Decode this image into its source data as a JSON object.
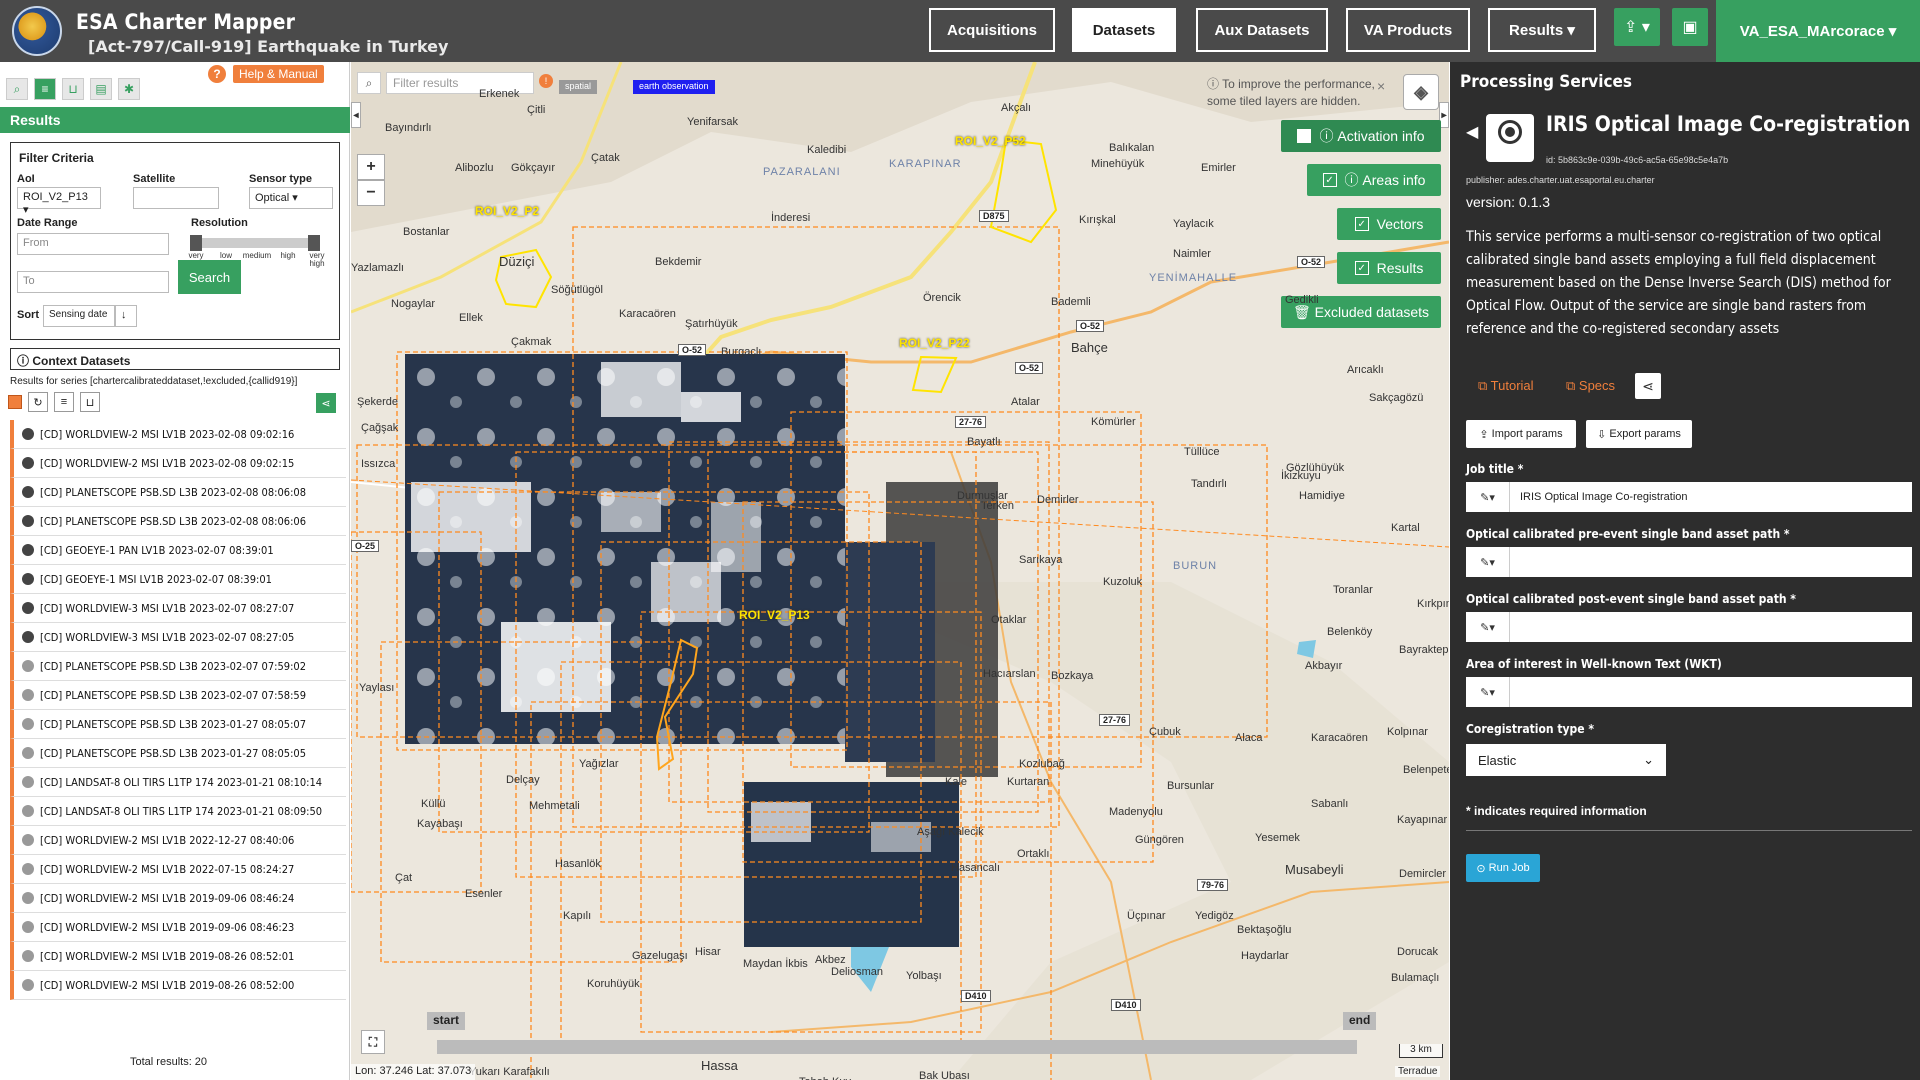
{
  "header": {
    "app_title": "ESA Charter Mapper",
    "activation_title": "[Act-797/Call-919] Earthquake in Turkey",
    "nav": [
      "Acquisitions",
      "Datasets",
      "Aux Datasets",
      "VA Products",
      "Results ▾"
    ],
    "active_nav": "Datasets",
    "upload_label": "⇪ ▾",
    "briefcase_label": "▣",
    "user": "VA_ESA_MArcorace ▾"
  },
  "left_panel": {
    "help_q": "?",
    "help_label": "Help & Manual",
    "results_label": "Results",
    "filter": {
      "title": "Filter Criteria",
      "aoi_label": "AoI",
      "aoi_value": "ROI_V2_P13",
      "satellite_label": "Satellite",
      "satellite_value": "",
      "sensor_label": "Sensor type",
      "sensor_value": "Optical",
      "date_label": "Date Range",
      "from_placeholder": "From",
      "to_placeholder": "To",
      "resolution_label": "Resolution",
      "resolution_ticks": [
        "very low",
        "low",
        "medium",
        "high",
        "very high"
      ],
      "sort_label": "Sort",
      "sort_value": "Sensing date",
      "search_label": "Search"
    },
    "context_title": "Context Datasets",
    "context_subtitle": "Results for series [chartercalibrateddataset,!excluded,{callid919}]",
    "datasets": [
      {
        "label": "[CD] WORLDVIEW-2 MSI LV1B 2023-02-08 09:02:16",
        "dark": true
      },
      {
        "label": "[CD] WORLDVIEW-2 MSI LV1B 2023-02-08 09:02:15",
        "dark": true
      },
      {
        "label": "[CD] PLANETSCOPE PSB.SD L3B 2023-02-08 08:06:08",
        "dark": true
      },
      {
        "label": "[CD] PLANETSCOPE PSB.SD L3B 2023-02-08 08:06:06",
        "dark": true
      },
      {
        "label": "[CD] GEOEYE-1 PAN LV1B 2023-02-07 08:39:01",
        "dark": true
      },
      {
        "label": "[CD] GEOEYE-1 MSI LV1B 2023-02-07 08:39:01",
        "dark": true
      },
      {
        "label": "[CD] WORLDVIEW-3 MSI LV1B 2023-02-07 08:27:07",
        "dark": true
      },
      {
        "label": "[CD] WORLDVIEW-3 MSI LV1B 2023-02-07 08:27:05",
        "dark": true
      },
      {
        "label": "[CD] PLANETSCOPE PSB.SD L3B 2023-02-07 07:59:02",
        "dark": false
      },
      {
        "label": "[CD] PLANETSCOPE PSB.SD L3B 2023-02-07 07:58:59",
        "dark": false
      },
      {
        "label": "[CD] PLANETSCOPE PSB.SD L3B 2023-01-27 08:05:07",
        "dark": false
      },
      {
        "label": "[CD] PLANETSCOPE PSB.SD L3B 2023-01-27 08:05:05",
        "dark": false
      },
      {
        "label": "[CD] LANDSAT-8 OLI TIRS L1TP 174 2023-01-21 08:10:14",
        "dark": false
      },
      {
        "label": "[CD] LANDSAT-8 OLI TIRS L1TP 174 2023-01-21 08:09:50",
        "dark": false
      },
      {
        "label": "[CD] WORLDVIEW-2 MSI LV1B 2022-12-27 08:40:06",
        "dark": false
      },
      {
        "label": "[CD] WORLDVIEW-2 MSI LV1B 2022-07-15 08:24:27",
        "dark": false
      },
      {
        "label": "[CD] WORLDVIEW-2 MSI LV1B 2019-09-06 08:46:24",
        "dark": false
      },
      {
        "label": "[CD] WORLDVIEW-2 MSI LV1B 2019-09-06 08:46:23",
        "dark": false
      },
      {
        "label": "[CD] WORLDVIEW-2 MSI LV1B 2019-08-26 08:52:01",
        "dark": false
      },
      {
        "label": "[CD] WORLDVIEW-2 MSI LV1B 2019-08-26 08:52:00",
        "dark": false
      }
    ],
    "total": "Total results: 20"
  },
  "map": {
    "filter_placeholder": "Filter results",
    "tag_spatial": "spatial",
    "tag_eo": "earth observation",
    "perf_note": "To improve the performance, some tiled layers are hidden.",
    "layers": [
      "Activation info",
      "Areas info",
      "Vectors",
      "Results",
      "Excluded datasets"
    ],
    "roi_labels": [
      "ROI_V2_P2",
      "ROI_V2_P52",
      "ROI_V2_P22",
      "ROI_V2_P13"
    ],
    "place_labels": [
      "Erkenek",
      "Çitli",
      "Yenifarsak",
      "Akçalı",
      "Bayındırlı",
      "Çatak",
      "Kaledibi",
      "Balıkalan",
      "Alibozlu",
      "Gökçayır",
      "PAZARALANI",
      "KARAPINAR",
      "Minehüyük",
      "Emirler",
      "Bostanlar",
      "Düziçi",
      "İnderesi",
      "Yaylacık",
      "Yazlamazlı",
      "Bekdemir",
      "Kırışkal",
      "Naimler",
      "Söğütlügöl",
      "YENİMAHALLE",
      "Nogaylar",
      "Ellek",
      "Karacaören",
      "Örencik",
      "Bademli",
      "Gedikli",
      "Şatırhüyük",
      "Bahçe",
      "Çakmak",
      "Burgaçlı",
      "Arıcaklı",
      "Atalar",
      "Sakçagözü",
      "Kömürler",
      "Bayatlı",
      "Tüllüce",
      "Gözlühüyük",
      "Tandırlı",
      "İkizkuyu",
      "Demirler",
      "Terken",
      "Hamidiye",
      "Durmuşlar",
      "Kartal",
      "BURUN",
      "Sarıkaya",
      "Kuzoluk",
      "Toranlar",
      "Kırkpınar",
      "Otaklar",
      "Belenköy",
      "Bayraktepe",
      "Akbayır",
      "Hacıarslan",
      "Bozkaya",
      "Çubuk",
      "Alaca",
      "Karacaören",
      "Kolpınar",
      "Kozlubağ",
      "Belenpete",
      "Bursunlar",
      "Sabanlı",
      "Madenyolu",
      "Kayapınar",
      "Kale",
      "Kurtaran",
      "Aşağı Kalecik",
      "Ortaklı",
      "Güngören",
      "Yesemek",
      "Hasancalı",
      "Musabeyli",
      "Demircler",
      "Üçpınar",
      "Yedigöz",
      "Bektaşoğlu",
      "Dorucak",
      "Haydarlar",
      "Delçay",
      "Mehmetali",
      "Kayabaşı",
      "Hasanlök",
      "Çat",
      "Esenler",
      "Kapılı",
      "Gazelugaşı",
      "Akbez",
      "Yolbaşı",
      "Deliosman",
      "Hisar",
      "Bulamaçlı",
      "Maydan İkbis",
      "Koruhüyük",
      "Hassa",
      "Yukarı Karafakılı",
      "Tabah Kuy",
      "Bak Ubası",
      "Söğütlü",
      "Küllü",
      "Yağızlar",
      "Şekerde",
      "Çağşak",
      "Issızca",
      "Yaylası"
    ],
    "road_labels": [
      "D875",
      "O-52",
      "O-52",
      "O-52",
      "O-52",
      "27-76",
      "27-76",
      "79-76",
      "D410",
      "D410",
      "O-25"
    ],
    "timeline_start": "start",
    "timeline_end": "end",
    "coords": "Lon: 37.246 Lat: 37.073",
    "scale": "3 km",
    "attribution": "Terradue"
  },
  "right_panel": {
    "title": "Processing Services",
    "service_name": "IRIS Optical Image Co-registration",
    "service_id": "id: 5b863c9e-039b-49c6-ac5a-65e98c5e4a7b",
    "publisher": "publisher: ades.charter.uat.esaportal.eu.charter",
    "version": "version: 0.1.3",
    "description": "This service performs a multi-sensor co-registration of two optical calibrated single band assets employing a full field displacement measurement based on the Dense Inverse Search (DIS) method for Optical Flow. Output of the service are single band rasters from reference and the co-registered secondary assets",
    "tutorial": "Tutorial",
    "specs": "Specs",
    "import_params": "Import params",
    "export_params": "Export params",
    "fields": [
      {
        "label": "Job title *",
        "value": "IRIS Optical Image Co-registration"
      },
      {
        "label": "Optical calibrated pre-event single band asset path *",
        "value": ""
      },
      {
        "label": "Optical calibrated post-event single band asset path *",
        "value": ""
      },
      {
        "label": "Area of interest in Well-known Text (WKT)",
        "value": ""
      }
    ],
    "coreg_label": "Coregistration type *",
    "coreg_value": "Elastic",
    "required_note": "* indicates required information",
    "run_job": "Run Job"
  }
}
